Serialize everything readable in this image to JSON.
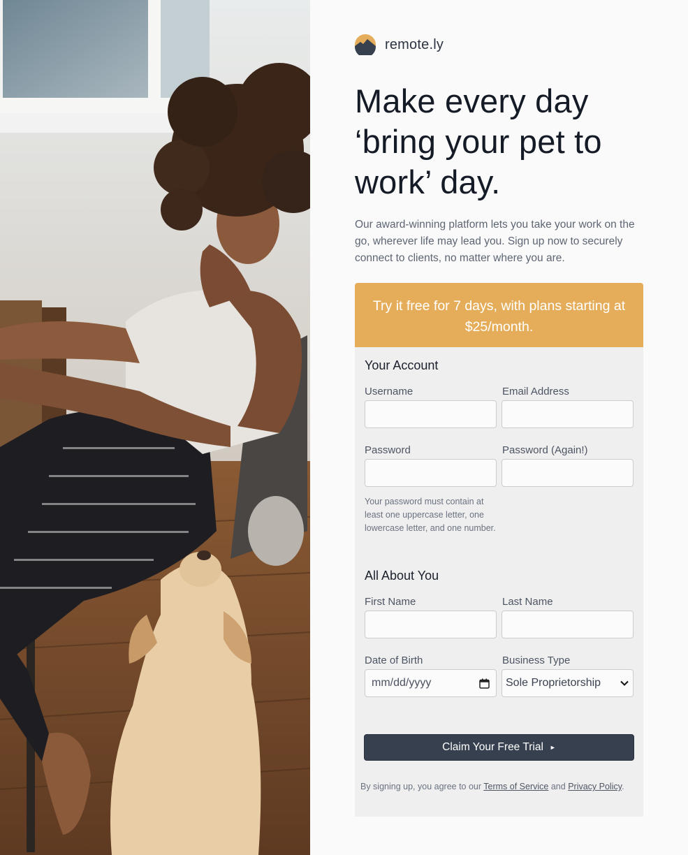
{
  "brand": {
    "name": "remote.ly",
    "logo_icon": "mountain-sun-logo",
    "accent": "#e5ad59",
    "dark": "#36404f"
  },
  "hero": {
    "headline_lines": [
      "Make every day",
      "‘bring your pet to",
      "work’ day."
    ],
    "intro": "Our award-winning platform lets you take your work on the go, wherever life may lead you. Sign up now to securely connect to clients, no matter where you are."
  },
  "promo": {
    "text": "Try it free for 7 days, with plans starting at $25/month."
  },
  "account": {
    "title": "Your Account",
    "username_label": "Username",
    "username_value": "",
    "email_label": "Email Address",
    "email_value": "",
    "password_label": "Password",
    "password_value": "",
    "password_again_label": "Password (Again!)",
    "password_again_value": "",
    "password_hint": "Your password must contain at least one uppercase letter, one lowercase letter, and one number."
  },
  "about": {
    "title": "All About You",
    "first_name_label": "First Name",
    "first_name_value": "",
    "last_name_label": "Last Name",
    "last_name_value": "",
    "dob_label": "Date of Birth",
    "dob_placeholder": "mm/dd/yyyy",
    "business_type_label": "Business Type",
    "business_type_selected": "Sole Proprietorship"
  },
  "cta": {
    "label": "Claim Your Free Trial",
    "arrow": "►"
  },
  "legal": {
    "prefix": "By signing up, you agree to our ",
    "terms": "Terms of Service",
    "middle": " and ",
    "privacy": "Privacy Policy",
    "suffix": "."
  }
}
